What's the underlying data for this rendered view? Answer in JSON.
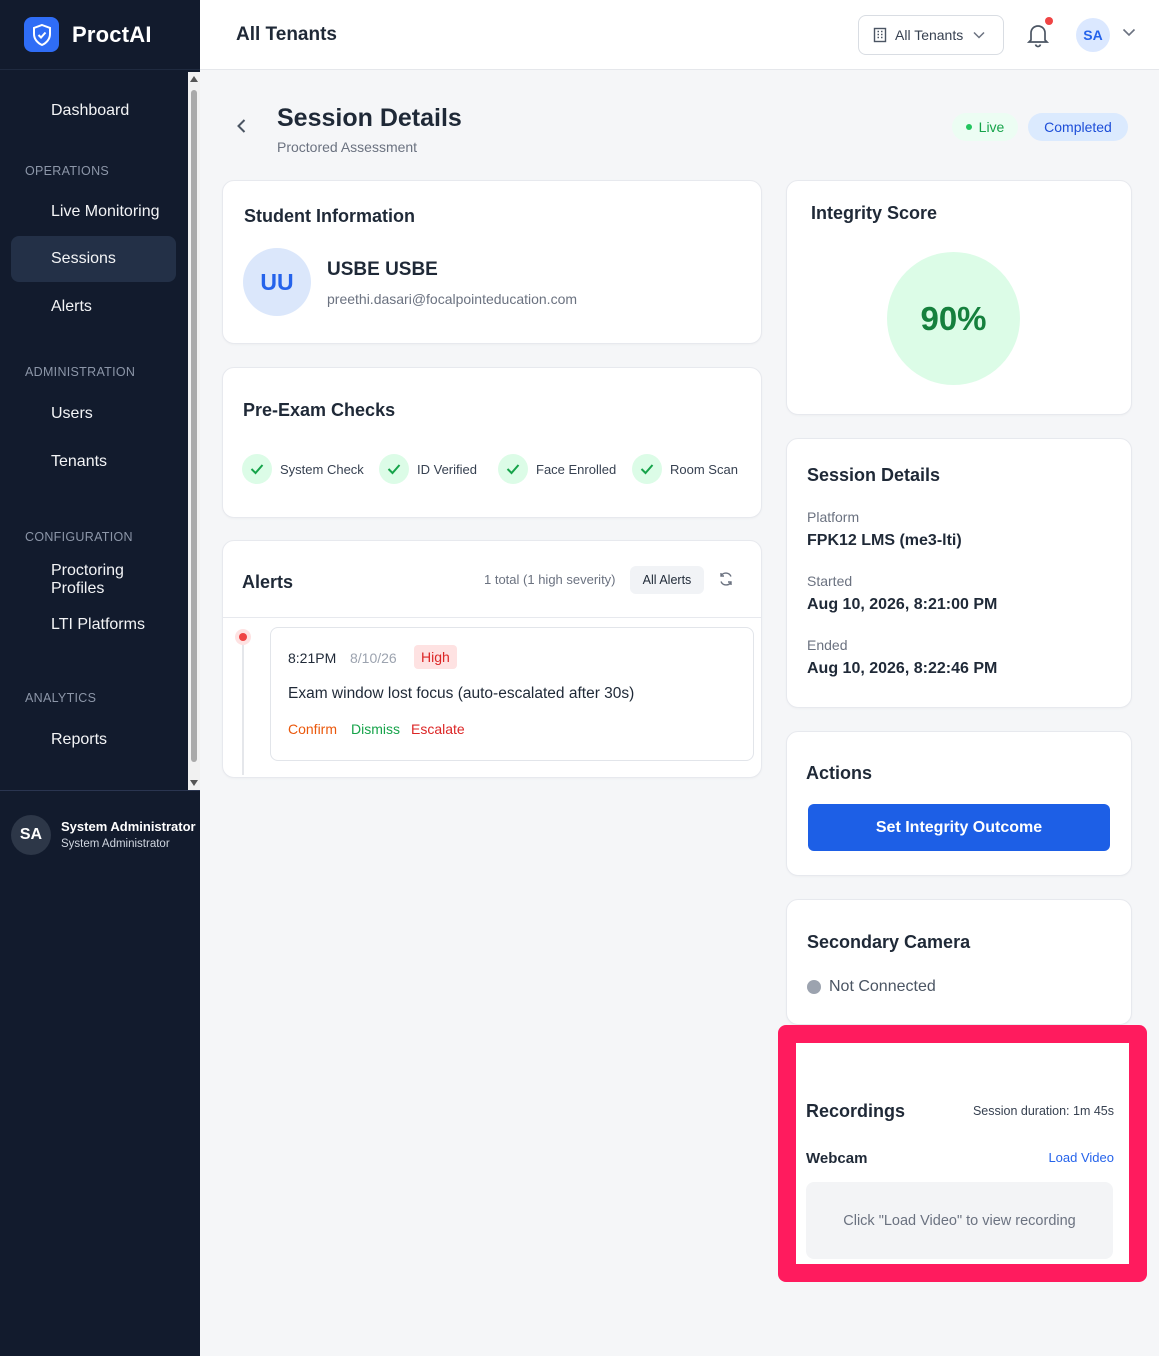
{
  "brand": {
    "name": "ProctAI"
  },
  "sidebar": {
    "items": [
      {
        "label": "Dashboard"
      },
      {
        "label": "Live Monitoring"
      },
      {
        "label": "Sessions"
      },
      {
        "label": "Alerts"
      },
      {
        "label": "Users"
      },
      {
        "label": "Tenants"
      },
      {
        "label": "Proctoring Profiles"
      },
      {
        "label": "LTI Platforms"
      },
      {
        "label": "Reports"
      }
    ],
    "sections": {
      "operations": "OPERATIONS",
      "administration": "ADMINISTRATION",
      "configuration": "CONFIGURATION",
      "analytics": "ANALYTICS"
    },
    "user": {
      "initials": "SA",
      "name": "System Administrator",
      "role": "System Administrator"
    }
  },
  "header": {
    "title": "All Tenants",
    "tenant_select": "All Tenants",
    "avatar_initials": "SA"
  },
  "page": {
    "title": "Session Details",
    "subtitle": "Proctored Assessment",
    "badges": {
      "live": "Live",
      "completed": "Completed"
    }
  },
  "student": {
    "card_title": "Student Information",
    "initials": "UU",
    "name": "USBE USBE",
    "email": "preethi.dasari@focalpointeducation.com"
  },
  "checks": {
    "card_title": "Pre-Exam Checks",
    "items": [
      {
        "label": "System Check"
      },
      {
        "label": "ID Verified"
      },
      {
        "label": "Face Enrolled"
      },
      {
        "label": "Room Scan"
      }
    ]
  },
  "alerts": {
    "card_title": "Alerts",
    "summary": "1 total (1 high severity)",
    "filter": "All Alerts",
    "items": [
      {
        "time": "8:21PM",
        "date": "8/10/26",
        "severity": "High",
        "message": "Exam window lost focus (auto-escalated after 30s)",
        "actions": {
          "confirm": "Confirm",
          "dismiss": "Dismiss",
          "escalate": "Escalate"
        }
      }
    ]
  },
  "integrity": {
    "card_title": "Integrity Score",
    "score": "90%"
  },
  "session": {
    "card_title": "Session Details",
    "platform_label": "Platform",
    "platform_value": "FPK12 LMS (me3-lti)",
    "started_label": "Started",
    "started_value": "Aug 10, 2026, 8:21:00 PM",
    "ended_label": "Ended",
    "ended_value": "Aug 10, 2026, 8:22:46 PM"
  },
  "actions": {
    "card_title": "Actions",
    "button": "Set Integrity Outcome"
  },
  "camera": {
    "card_title": "Secondary Camera",
    "status": "Not Connected"
  },
  "recordings": {
    "title": "Recordings",
    "duration": "Session duration: 1m 45s",
    "webcam_label": "Webcam",
    "load_link": "Load Video",
    "placeholder": "Click \"Load Video\" to view recording"
  },
  "colors": {
    "sidebar_bg": "#121b2d",
    "primary": "#1d5fe6",
    "success": "#16a34a",
    "danger": "#dc2626",
    "highlight": "#ff1b5e"
  }
}
